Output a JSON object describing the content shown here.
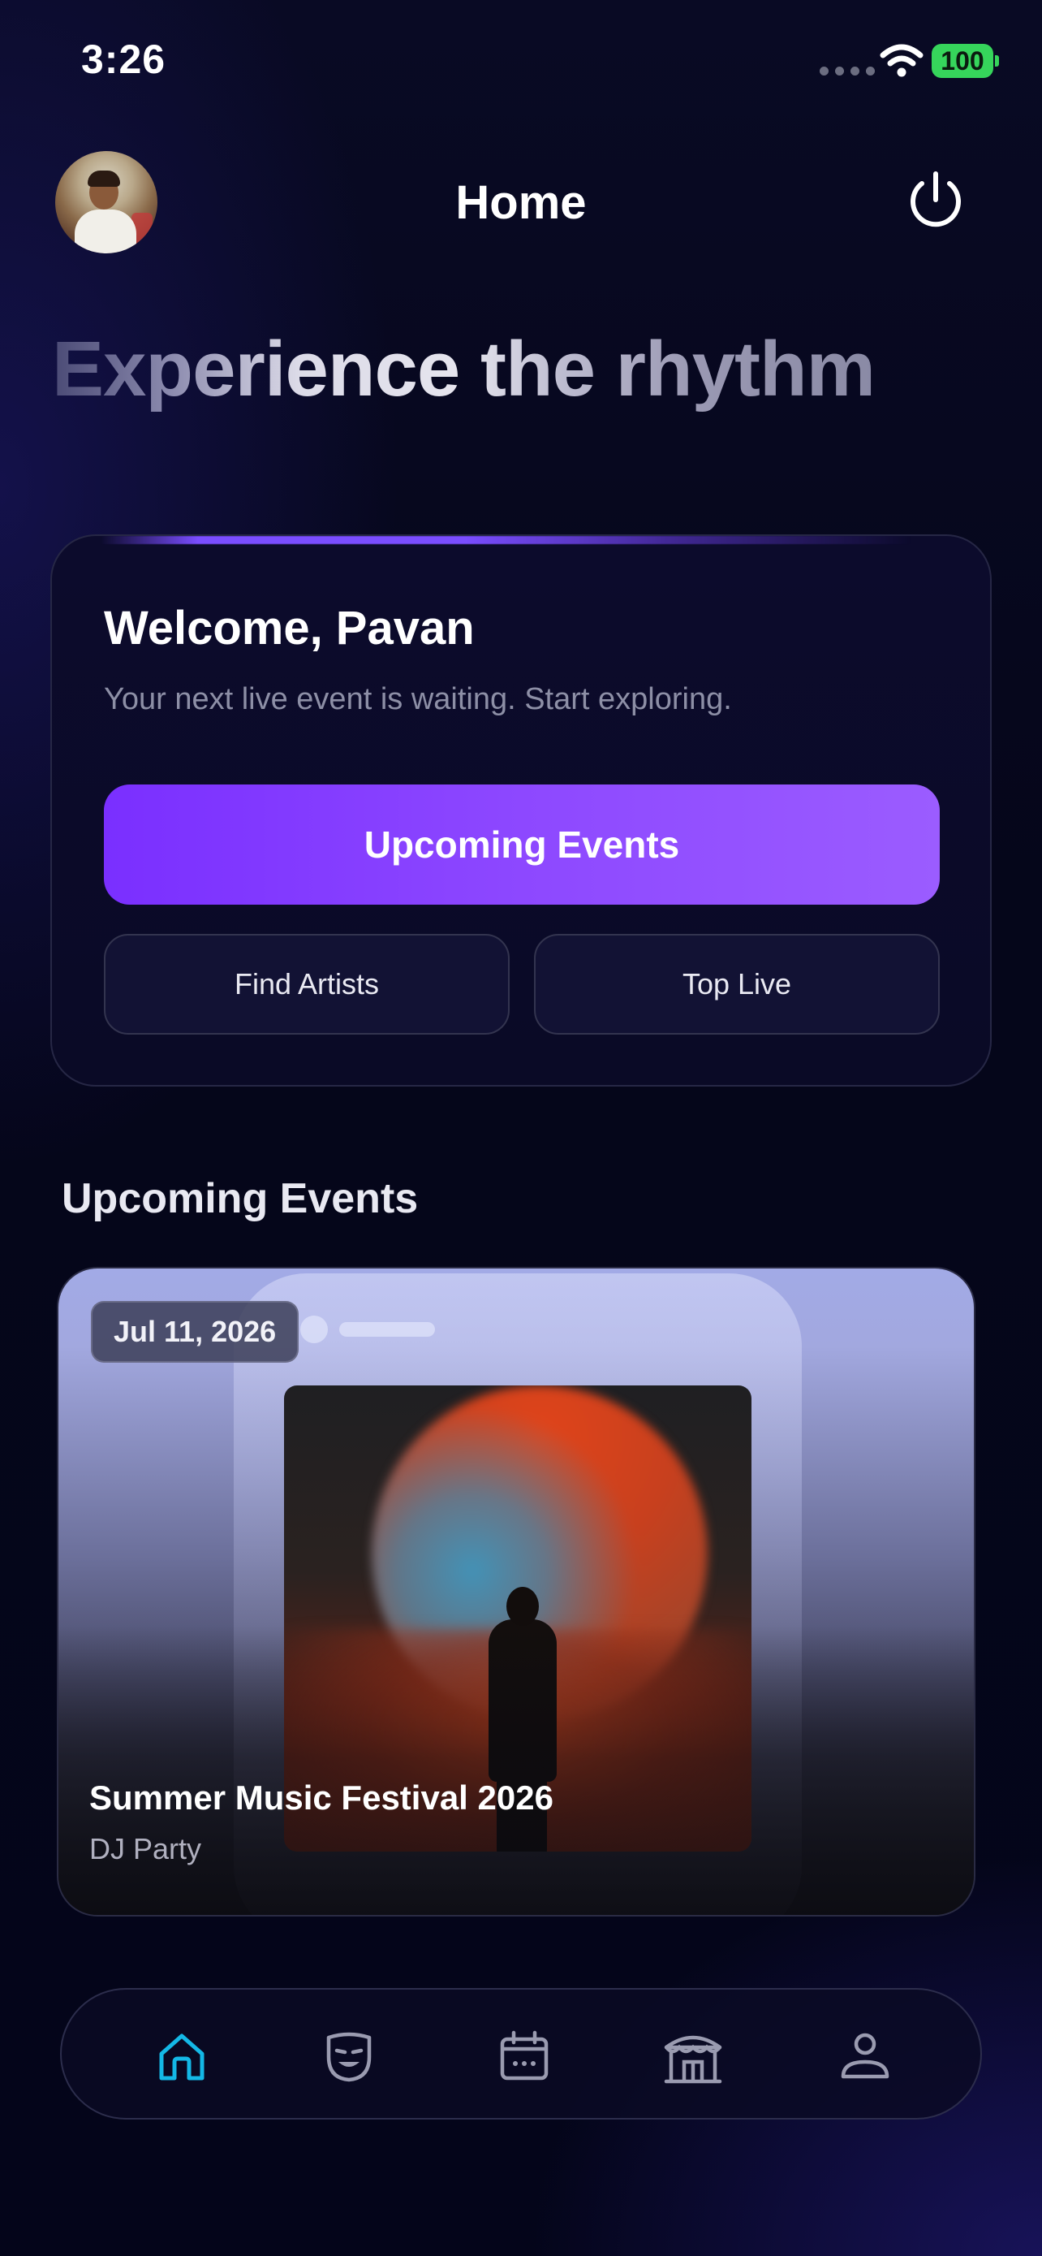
{
  "status_bar": {
    "time": "3:26",
    "battery": "100",
    "battery_color": "#36d55b"
  },
  "header": {
    "title": "Home",
    "avatar_icon": "user-avatar-photo",
    "power_icon": "power-icon"
  },
  "hero": {
    "heading": "Experience the rhythm"
  },
  "welcome_card": {
    "title": "Welcome, Pavan",
    "subtitle": "Your next live event is waiting. Start exploring.",
    "primary_button": "Upcoming Events",
    "find_artists_button": "Find Artists",
    "top_live_button": "Top Live",
    "accent_color": "#7a4dff"
  },
  "upcoming": {
    "section_title": "Upcoming Events",
    "events": [
      {
        "date": "Jul 11, 2026",
        "title": "Summer Music Festival 2026",
        "category": "DJ Party"
      }
    ]
  },
  "bottom_nav": {
    "items": [
      {
        "icon": "home-icon",
        "active": true
      },
      {
        "icon": "artist-mask-icon",
        "active": false
      },
      {
        "icon": "calendar-icon",
        "active": false
      },
      {
        "icon": "venue-tent-icon",
        "active": false
      },
      {
        "icon": "profile-icon",
        "active": false
      }
    ],
    "active_color": "#14b8e6",
    "inactive_color": "#9a9bb0"
  }
}
